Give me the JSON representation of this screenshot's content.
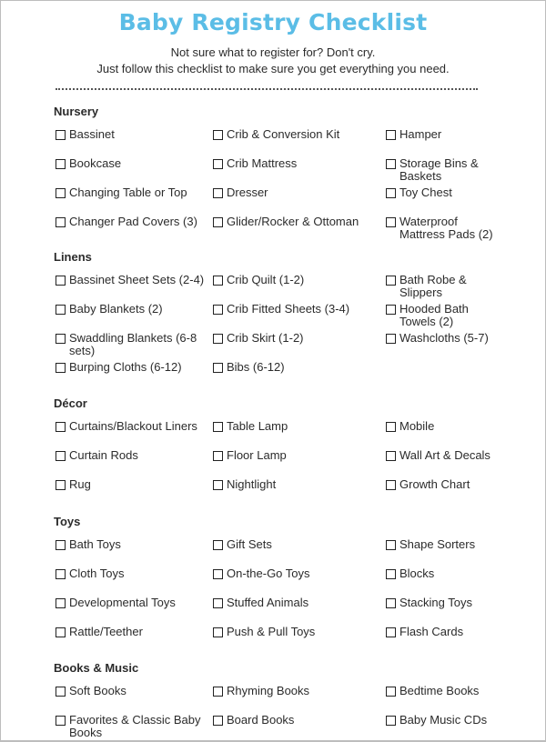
{
  "header": {
    "title": "Baby Registry Checklist",
    "subtitle_line1": "Not sure what to register for? Don't cry.",
    "subtitle_line2": "Just follow this checklist to make sure you get everything you need.",
    "title_color": "#5bbde6"
  },
  "sections": [
    {
      "title": "Nursery",
      "items": [
        [
          "Bassinet",
          "Crib & Conversion Kit",
          "Hamper"
        ],
        [
          "Bookcase",
          "Crib Mattress",
          "Storage Bins & Baskets"
        ],
        [
          "Changing Table or Top",
          "Dresser",
          "Toy Chest"
        ],
        [
          "Changer Pad Covers (3)",
          "Glider/Rocker & Ottoman",
          "Waterproof Mattress Pads (2)"
        ]
      ]
    },
    {
      "title": "Linens",
      "items": [
        [
          "Bassinet Sheet Sets (2-4)",
          "Crib Quilt (1-2)",
          "Bath Robe & Slippers"
        ],
        [
          "Baby Blankets (2)",
          "Crib Fitted Sheets (3-4)",
          "Hooded Bath Towels (2)"
        ],
        [
          "Swaddling Blankets (6-8 sets)",
          "Crib Skirt (1-2)",
          "Washcloths (5-7)"
        ],
        [
          "Burping Cloths (6-12)",
          "Bibs (6-12)",
          ""
        ]
      ]
    },
    {
      "title": "Décor",
      "items": [
        [
          "Curtains/Blackout Liners",
          "Table Lamp",
          "Mobile"
        ],
        [
          "Curtain Rods",
          "Floor Lamp",
          "Wall Art & Decals"
        ],
        [
          "Rug",
          "Nightlight",
          "Growth Chart"
        ]
      ]
    },
    {
      "title": "Toys",
      "items": [
        [
          "Bath Toys",
          "Gift Sets",
          "Shape Sorters"
        ],
        [
          "Cloth Toys",
          "On-the-Go Toys",
          "Blocks"
        ],
        [
          "Developmental Toys",
          "Stuffed Animals",
          "Stacking Toys"
        ],
        [
          "Rattle/Teether",
          "Push & Pull Toys",
          "Flash Cards"
        ]
      ]
    },
    {
      "title": "Books & Music",
      "items": [
        [
          "Soft Books",
          "Rhyming Books",
          "Bedtime Books"
        ],
        [
          "Favorites & Classic Baby Books",
          "Board Books",
          "Baby Music CDs"
        ]
      ]
    }
  ]
}
